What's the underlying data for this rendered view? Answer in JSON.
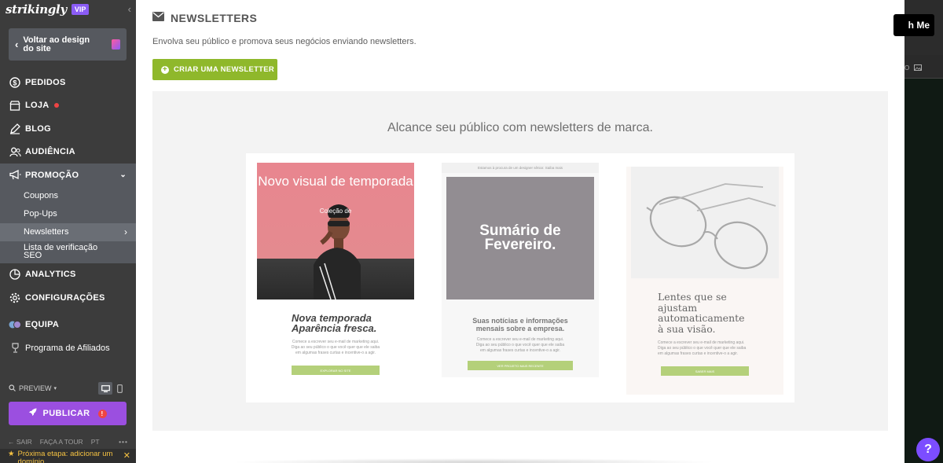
{
  "sidebar": {
    "logo": "strikingly",
    "vip_badge": "VIP",
    "back_button": "Voltar ao design do site",
    "nav": [
      {
        "label": "PEDIDOS",
        "icon": "dollar-icon"
      },
      {
        "label": "LOJA",
        "icon": "store-icon",
        "has_dot": true
      },
      {
        "label": "BLOG",
        "icon": "pen-icon"
      },
      {
        "label": "AUDIÊNCIA",
        "icon": "people-icon"
      },
      {
        "label": "PROMOÇÃO",
        "icon": "megaphone-icon",
        "expanded": true
      }
    ],
    "promo_sub": [
      {
        "label": "Coupons"
      },
      {
        "label": "Pop-Ups"
      },
      {
        "label": "Newsletters",
        "active": true
      },
      {
        "label": "Lista de verificação SEO"
      }
    ],
    "nav_after": [
      {
        "label": "ANALYTICS",
        "icon": "chart-icon"
      },
      {
        "label": "CONFIGURAÇÕES",
        "icon": "gear-icon"
      },
      {
        "label": "EQUIPA",
        "icon": "team-icon"
      },
      {
        "label": "Programa de Afiliados",
        "icon": "trophy-icon"
      }
    ],
    "preview_label": "PREVIEW",
    "publish_label": "PUBLICAR",
    "footer": {
      "exit": "SAIR",
      "tour": "FAÇA A TOUR",
      "lang": "PT",
      "more": "•••"
    },
    "next_step": "Próxima etapa: adicionar um domínio"
  },
  "main": {
    "title": "NEWSLETTERS",
    "description": "Envolva seu público e promova seus negócios enviando newsletters.",
    "create_button": "CRIAR UMA NEWSLETTER",
    "promo_title": "Alcance seu público com newsletters de marca.",
    "card1": {
      "image_text": "Novo visual de temporada",
      "image_subtext": "Coleção de",
      "heading": "Nova temporada Aparência fresca.",
      "body": "Comece a escrever seu e-mail de marketing aqui. Diga ao seu público o que você quer que ele saiba em algumas frases curtas e incentive-o a agir.",
      "button": "EXPLORAR NO SITE"
    },
    "card2": {
      "top_note": "Estamos à procura de um designer sênior. Saiba mais",
      "image_text": "Sumário de Fevereiro.",
      "heading": "Suas notícias e informações mensais sobre a empresa.",
      "body": "Comece a escrever seu e-mail de marketing aqui. Diga ao seu público o que você quer que ele saiba em algumas frases curtas e incentive-o a agir.",
      "button": "VER PROJETO MAIS RECENTE"
    },
    "card3": {
      "heading": "Lentes que se ajustam automaticamente à sua visão.",
      "body": "Comece a escrever seu e-mail de marketing aqui. Diga ao seu público o que você quer que ele saiba em algumas frases curtas e incentive-o a agir.",
      "button": "SABER MAIS"
    }
  },
  "right": {
    "watch_button": "h Me",
    "strip_text": "O"
  },
  "help_icon": "?",
  "colors": {
    "sidebar_bg": "#3c3c3c",
    "accent_green": "#8fb82b",
    "publish_purple": "#9b4fe0",
    "vip_purple": "#8b5cf6"
  }
}
